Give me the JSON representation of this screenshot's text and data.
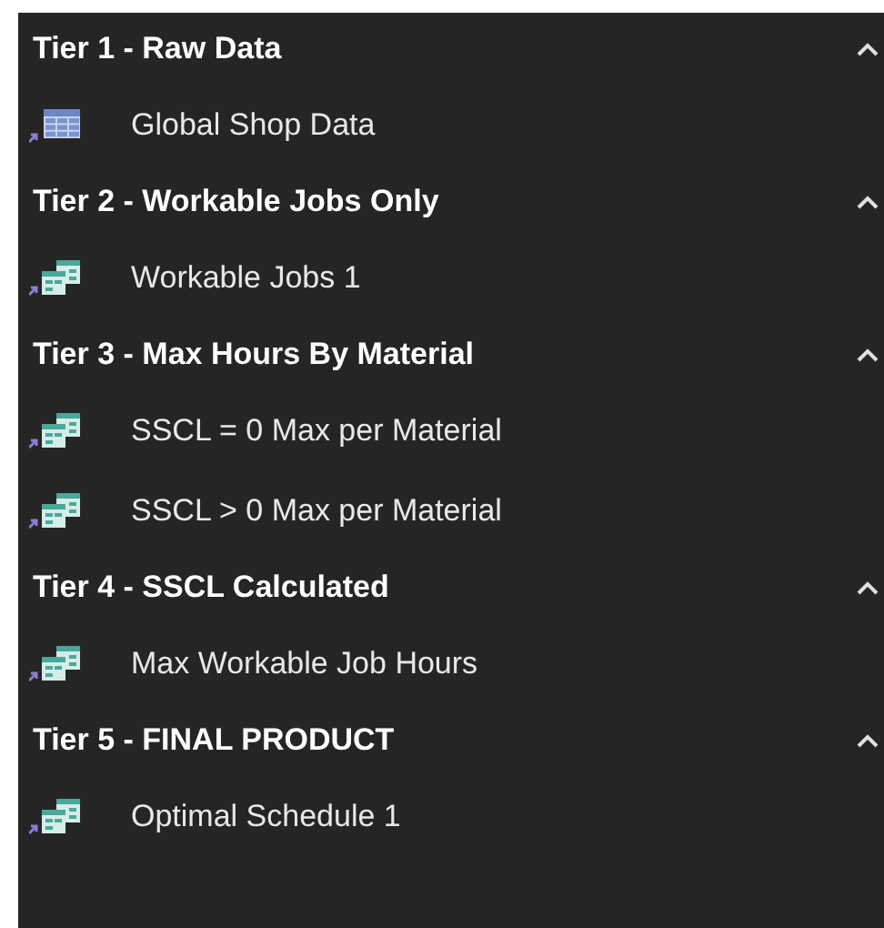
{
  "groups": [
    {
      "title": "Tier 1 - Raw Data",
      "expanded": true,
      "items": [
        {
          "label": "Global Shop Data",
          "kind": "table"
        }
      ]
    },
    {
      "title": "Tier 2 - Workable Jobs Only",
      "expanded": true,
      "items": [
        {
          "label": "Workable Jobs 1",
          "kind": "query"
        }
      ]
    },
    {
      "title": "Tier 3 - Max Hours By Material",
      "expanded": true,
      "items": [
        {
          "label": "SSCL = 0 Max per Material",
          "kind": "query"
        },
        {
          "label": "SSCL > 0 Max per Material",
          "kind": "query"
        }
      ]
    },
    {
      "title": "Tier 4 - SSCL Calculated",
      "expanded": true,
      "items": [
        {
          "label": "Max Workable Job Hours",
          "kind": "query"
        }
      ]
    },
    {
      "title": "Tier 5 - FINAL PRODUCT",
      "expanded": true,
      "items": [
        {
          "label": "Optimal Schedule 1",
          "kind": "query"
        }
      ]
    }
  ]
}
